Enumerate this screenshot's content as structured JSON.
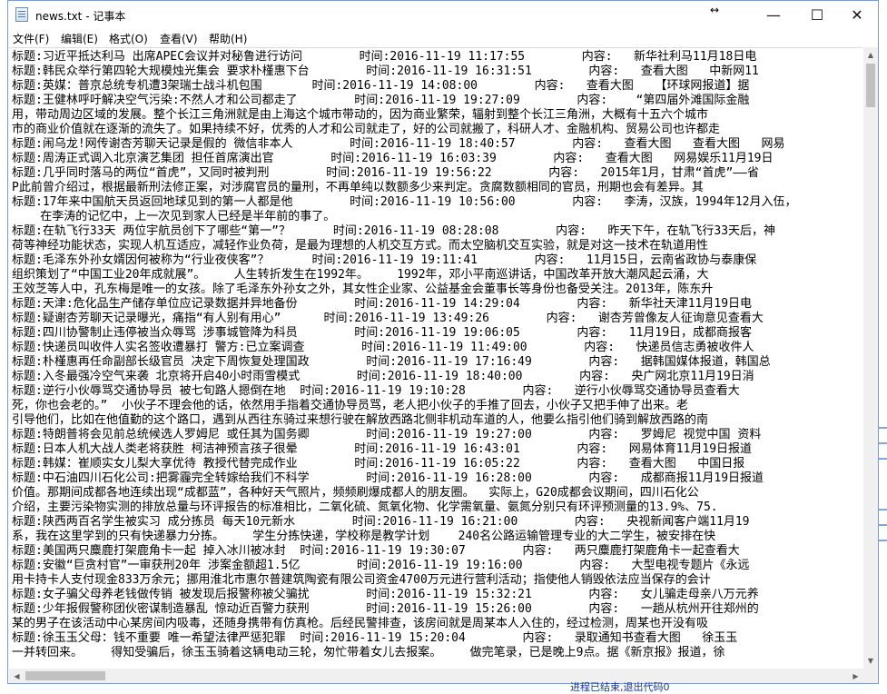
{
  "window": {
    "title": "news.txt - 记事本",
    "minimize_glyph": "—",
    "maximize_glyph": "☐",
    "close_glyph": "✕",
    "resize_glyph": "↔"
  },
  "menu": [
    {
      "label": "文件(F)"
    },
    {
      "label": "编辑(E)"
    },
    {
      "label": "格式(O)"
    },
    {
      "label": "查看(V)"
    },
    {
      "label": "帮助(H)"
    }
  ],
  "editor": {
    "lines": [
      "标题:习近平抵达利马 出席APEC会议并对秘鲁进行访问        时间:2016-11-19 11:17:55        内容:   新华社利马11月18日电",
      "标题:韩民众举行第四轮大规模烛光集会 要求朴槿惠下台        时间:2016-11-19 16:31:51        内容:   查看大图   中新网11",
      "标题:英媒：普京总统专机遭3架瑞士战斗机包围       时间:2016-11-19 14:08:00        内容:   查看大图   【环球网报道】据",
      "标题:王健林呼吁解决空气污染:不然人才和公司都走了        时间:2016-11-19 19:27:09        内容:    “第四届外滩国际金融",
      "用，带动周边区域的发展。整个长江三角洲就是由上海这个城市带动的，因为商业繁荣，辐射到整个长江三角洲，大概有十五六个城市",
      "市的商业价值就在逐渐的流失了。如果持续不好，优秀的人才和公司就走了，好的公司就搬了，科研人才、金融机构、贸易公司也许都走",
      "标题:闹乌龙!网传谢杏芳聊天记录是假的 微信非本人        时间:2016-11-19 18:40:57        内容:   查看大图   查看大图   网易",
      "标题:周涛正式调入北京演艺集团 担任首席演出官        时间:2016-11-19 16:03:39        内容:   查看大图   网易娱乐11月19日",
      "标题:几乎同时落马的两位“首虎”，又同时被判刑        时间:2016-11-19 19:56:22        内容:   2015年1月，甘肃“首虎”——省",
      "P此前曾介绍过，根据最新刑法修正案，对涉腐官员的量刑，不再单纯以数额多少来判定。贪腐数额相同的官员，刑期也会有差异。其",
      "标题:17年来中国航天员返回地球见到的第一人都是他        时间:2016-11-19 10:56:00        内容:   李涛，汉族，1994年12月入伍，",
      "    在李涛的记忆中，上一次见到家人已经是半年前的事了。",
      "标题:在轨飞行33天 两位宇航员创下了哪些“第一”？      时间:2016-11-19 08:28:08        内容:   昨天下午，在轨飞行33天后，神",
      "荷等神经功能状态，实现人机互适应，减轻作业负荷，是最为理想的人机交互方式。而太空脑机交互实验，就是对这一技术在轨道用性",
      "标题:毛泽东外孙女婿因何被称为“行业夜侠客”？      时间:2016-11-19 19:11:41        内容:   11月15日，云南省政协与泰康保",
      "组织策划了“中国工业20年成就展”。    人生转折发生在1992年。    1992年，邓小平南巡讲话，中国改革开放大潮风起云涌，大",
      "王效芝等人中，孔东梅是唯一的女孩。除了毛泽东外孙女之外，其女性企业家、公益基金会董事长等身份也备受关注。2013年，陈东升",
      "标题:天津:危化品生产储存单位应记录数据并异地备份        时间:2016-11-19 14:29:04        内容:   新华社天津11月19日电",
      "标题:疑谢杏芳聊天记录曝光，痛指“有人别有用心”      时间:2016-11-19 13:49:26        内容:   谢杏芳曾像友人征询意见查看大",
      "标题:四川协警制止违停被当众辱骂 涉事城管降为科员        时间:2016-11-19 19:06:05        内容:   11月19日，成都商报客",
      "标题:快递员叫收件人实名签收遭暴打 警方:已立案调查        时间:2016-11-19 11:49:00        内容:   快递员信志勇被收件人",
      "标题:朴槿惠再任命副部长级官员 决定下周恢复处理国政        时间:2016-11-19 17:16:49        内容:   据韩国媒体报道，韩国总",
      "标题:入冬最强冷空气来袭 北京将开启40小时雨雪模式        时间:2016-11-19 18:40:00        内容:   央广网北京11月19日消",
      "标题:逆行小伙辱骂交通协导员 被七旬路人摁倒在地  时间:2016-11-19 19:10:28        内容:   逆行小伙辱骂交通协导员查看大",
      "死，你也会老的。”  小伙子不理会他的话，依然用手指着交通协导员骂，老人把小伙子的手推了回去，小伙子又把手伸了出来。老",
      "引导他们，比如在他值勤的这个路口，遇到从西往东骑过来想行驶在解放西路北侧非机动车道的人，他要么指引他们骑到解放西路的南",
      "标题:特朗普将会见前总统候选人罗姆尼 或任其为国务卿        时间:2016-11-19 19:27:00        内容:   罗姆尼 视觉中国 资料",
      "标题:日本人机大战人类老将获胜 柯洁神预言孩子很晕        时间:2016-11-19 16:43:01        内容:   网易体育11月19日报道",
      "标题:韩媒：崔顺实女儿梨大享优待 教授代替完成作业        时间:2016-11-19 16:05:22        内容:   查看大图   中国日报",
      "标题:中石油四川石化公司:把雾霾完全转嫁给我们不科学        时间:2016-11-19 16:28:00        内容:   成都商报11月19日报道",
      "价值。那期间成都各地连续出现“成都蓝”，各种好天气照片，频频刷爆成都人的朋友圈。  实际上，G20成都会议期间，四川石化公",
      "介绍，主要污染物实测的排放总量与环评报告的标准相比，二氧化硫、氮氧化物、化学需氧量、氨氮分别只有环评预测量的13.9%、75.",
      "标题:陕西两百名学生被实习 成分拣员 每天10元新水        时间:2016-11-19 16:21:00        内容:   央视新闻客户端11月19",
      "系，我在这里学到的只有快递暴力分拣。    学生分拣快递，学校称是教学计划    240名公路运输管理专业的大二学生，被安排在快",
      "标题:美国两只麋鹿打架鹿角卡一起 掉入冰川被冰封  时间:2016-11-19 19:30:07        内容:   两只麋鹿打架鹿角卡一起查看大",
      "标题:安徽“巨贪村官”一审获刑20年 涉案金额超1.5亿        时间:2016-11-19 19:16:00        内容:   大型电视专题片《永远",
      "用卡持卡人支付现金833万余元；挪用淮北市惠尔普建筑陶瓷有限公司资金4700万元进行营利活动；指使他人销毁依法应当保存的会计",
      "标题:女子骗父母养老钱做传销 被发现后报警称被父骗扰        时间:2016-11-19 15:32:21        内容:   女儿骗走母亲八万元养",
      "标题:少年报假警称团伙密谋制造暴乱 惊动近百警力获刑        时间:2016-11-19 15:26:00        内容:   一趟从杭州开往郑州的",
      "某的男子在该活动中心某房间内吸毒，还随身携带有仿真枪。后经民警排查，该房间就是周某本人入住的，经过检测，周某也开没有吸",
      "标题:徐玉玉父母：钱不重要 唯一希望法律严惩犯罪  时间:2016-11-19 15:20:04        内容:   录取通知书查看大图   徐玉玉",
      "一并转回来。    得知受骗后，徐玉玉骑着这辆电动三轮，匆忙带着女儿去报案。    做完笔录，已是晚上9点。据《新京报》报道，徐"
    ]
  },
  "background": {
    "visible_text": "进程已结束,退出代码0"
  }
}
